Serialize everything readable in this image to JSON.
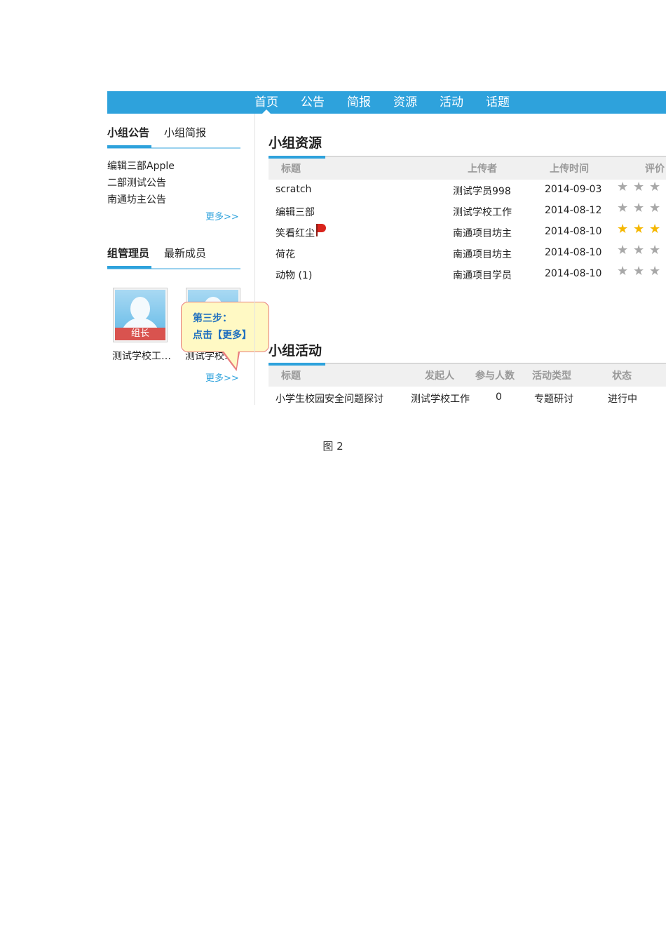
{
  "nav": {
    "items": [
      "首页",
      "公告",
      "简报",
      "资源",
      "活动",
      "话题"
    ],
    "active_index": 0
  },
  "sidebar": {
    "announcements": {
      "tab_active": "小组公告",
      "tab_other": "小组简报",
      "items": [
        "编辑三部Apple",
        "二部测试公告",
        "南通坊主公告"
      ],
      "more": "更多>>"
    },
    "members": {
      "tab_active": "组管理员",
      "tab_other": "最新成员",
      "people": [
        {
          "name": "测试学校工…",
          "badge": "组长"
        },
        {
          "name": "测试学校…"
        }
      ],
      "more": "更多>>"
    }
  },
  "callout": {
    "line1": "第三步：",
    "line2": "点击【更多】"
  },
  "resources": {
    "title": "小组资源",
    "headers": [
      "标题",
      "上传者",
      "上传时间",
      "评价"
    ],
    "rows": [
      {
        "title": "scratch",
        "uploader": "测试学员998",
        "date": "2014-09-03",
        "rating": 0
      },
      {
        "title": "编辑三部",
        "uploader": "测试学校工作",
        "date": "2014-08-12",
        "rating": 0
      },
      {
        "title": "笑看红尘",
        "uploader": "南通项目坊主",
        "date": "2014-08-10",
        "rating": 3,
        "flag": true
      },
      {
        "title": "荷花",
        "uploader": "南通项目坊主",
        "date": "2014-08-10",
        "rating": 0
      },
      {
        "title": "动物 (1)",
        "uploader": "南通项目学员",
        "date": "2014-08-10",
        "rating": 0
      }
    ]
  },
  "activities": {
    "title": "小组活动",
    "headers": [
      "标题",
      "发起人",
      "参与人数",
      "活动类型",
      "状态"
    ],
    "rows": [
      {
        "title": "小学生校园安全问题探讨",
        "initiator": "测试学校工作",
        "participants": "0",
        "type": "专题研讨",
        "status": "进行中"
      }
    ]
  },
  "caption": "图 2"
}
